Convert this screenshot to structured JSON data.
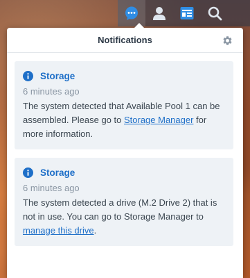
{
  "colors": {
    "accent": "#1e6fc8",
    "card_bg": "#eef2f6",
    "panel_bg": "#ffffff",
    "title_text": "#2f3b48"
  },
  "taskbar": {
    "icons": [
      "notifications-icon",
      "user-icon",
      "widgets-icon",
      "search-icon"
    ],
    "active": "notifications-icon"
  },
  "panel": {
    "title": "Notifications",
    "settings_icon": "gear-icon"
  },
  "notifications": [
    {
      "icon": "info-icon",
      "title": "Storage",
      "time": "6 minutes ago",
      "text_before": "The system detected that Available Pool 1 can be assembled. Please go to ",
      "link": "Storage Manager",
      "text_after": " for more information."
    },
    {
      "icon": "info-icon",
      "title": "Storage",
      "time": "6 minutes ago",
      "text_before": "The system detected a drive (M.2 Drive 2) that is not in use. You can go to Storage Manager to ",
      "link": "manage this drive",
      "text_after": "."
    }
  ]
}
